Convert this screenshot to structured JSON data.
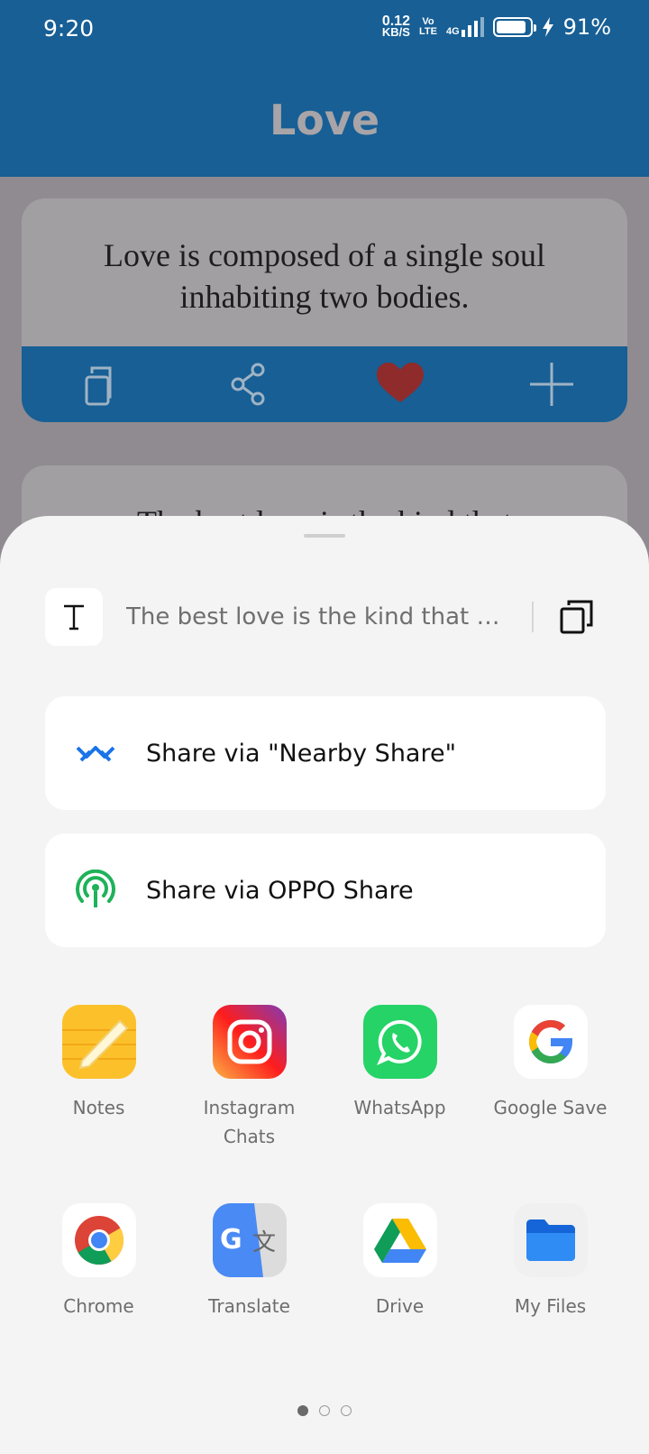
{
  "status": {
    "time": "9:20",
    "net_speed_value": "0.12",
    "net_speed_unit": "KB/S",
    "volte": "Vo LTE",
    "network": "4G",
    "battery": "91%",
    "battery_level": 0.91
  },
  "app": {
    "title": "Love",
    "cards": [
      {
        "quote": "Love is composed of a single soul inhabiting two bodies."
      },
      {
        "quote": "The best love is the kind that"
      }
    ],
    "actions": [
      "copy-icon",
      "share-icon",
      "heart-icon",
      "add-icon"
    ]
  },
  "sheet": {
    "preview_text": "The best love is the kind that awa…",
    "options": [
      {
        "label": "Share via \"Nearby Share\"",
        "icon": "nearby-share-icon"
      },
      {
        "label": "Share via OPPO Share",
        "icon": "oppo-share-icon"
      }
    ],
    "apps_row1": [
      {
        "name": "Notes"
      },
      {
        "name": "Instagram Chats"
      },
      {
        "name": "WhatsApp"
      },
      {
        "name": "Google Save"
      }
    ],
    "apps_row2": [
      {
        "name": "Chrome"
      },
      {
        "name": "Translate"
      },
      {
        "name": "Drive"
      },
      {
        "name": "My Files"
      }
    ],
    "page_indicator": {
      "pages": 3,
      "current": 1
    }
  },
  "colors": {
    "header": "#175f95",
    "sheet_bg": "#f4f4f4",
    "heart": "#8f2b2b",
    "nearby": "#1a73e8",
    "oppo": "#1fb25a"
  }
}
